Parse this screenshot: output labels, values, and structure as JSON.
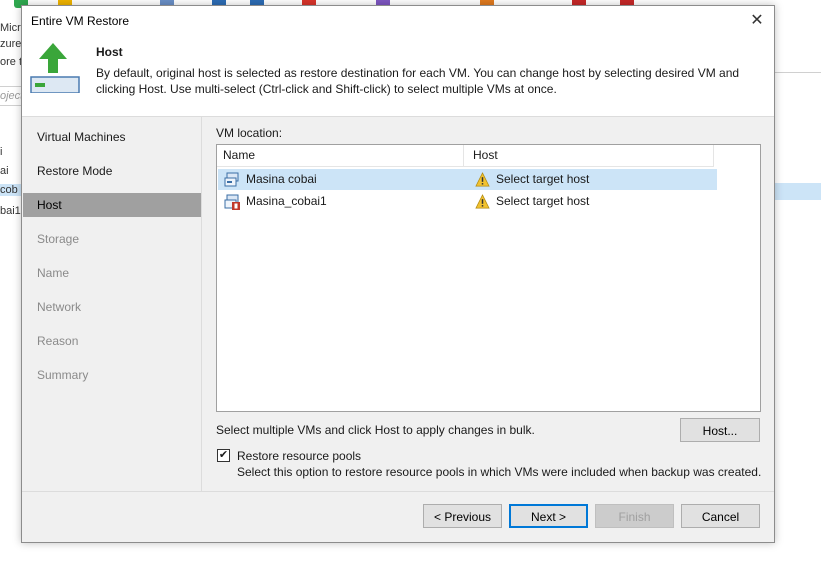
{
  "background": {
    "left_fragments": [
      "Micro",
      "zure",
      "ore to",
      "oject",
      "i",
      "ai",
      "cob",
      "bai1"
    ],
    "search_placeholder": "oject"
  },
  "dialog": {
    "title": "Entire VM Restore",
    "close_glyph": "✕",
    "header": {
      "icon": "green-up-arrow-vm-icon",
      "title": "Host",
      "description": "By default, original host is selected as restore destination for each VM. You can change host by selecting desired VM and clicking Host. Use multi-select (Ctrl-click and Shift-click) to select multiple VMs at once."
    },
    "steps": [
      {
        "label": "Virtual Machines",
        "state": "done"
      },
      {
        "label": "Restore Mode",
        "state": "done"
      },
      {
        "label": "Host",
        "state": "active"
      },
      {
        "label": "Storage",
        "state": "disabled"
      },
      {
        "label": "Name",
        "state": "disabled"
      },
      {
        "label": "Network",
        "state": "disabled"
      },
      {
        "label": "Reason",
        "state": "disabled"
      },
      {
        "label": "Summary",
        "state": "disabled"
      }
    ],
    "vm_location_label": "VM location:",
    "columns": {
      "name": "Name",
      "host": "Host"
    },
    "rows": [
      {
        "name": "Masina cobai",
        "host": "Select target host",
        "selected": true,
        "icon": "vm-icon",
        "status_icon": "warning-icon"
      },
      {
        "name": "Masina_cobai1",
        "host": "Select target host",
        "selected": false,
        "icon": "vm-error-icon",
        "status_icon": "warning-icon"
      }
    ],
    "bulk_hint": "Select multiple VMs and click Host to apply changes in bulk.",
    "host_button": "Host...",
    "restore_pools": {
      "checked": true,
      "label": "Restore resource pools",
      "description": "Select this option to restore resource pools in which VMs were included when backup was created."
    },
    "buttons": {
      "previous": "< Previous",
      "next": "Next >",
      "finish": "Finish",
      "cancel": "Cancel"
    }
  },
  "colors": {
    "selection": "#cce4f7",
    "active_step": "#a0a0a0",
    "accent": "#0078d7",
    "header_arrow": "#3aa63a"
  }
}
